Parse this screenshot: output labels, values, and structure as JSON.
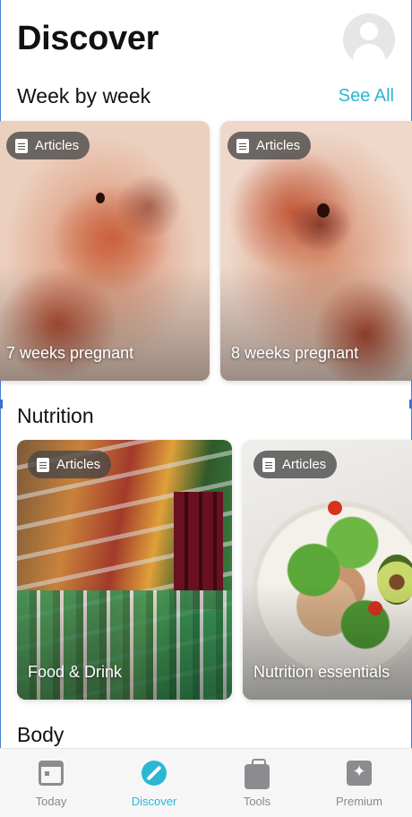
{
  "header": {
    "title": "Discover"
  },
  "week_section": {
    "title": "Week by week",
    "see_all": "See All",
    "cards": [
      {
        "badge": "Articles",
        "label": "7 weeks pregnant"
      },
      {
        "badge": "Articles",
        "label": "8 weeks pregnant"
      }
    ]
  },
  "nutrition_section": {
    "title": "Nutrition",
    "cards": [
      {
        "badge": "Articles",
        "label": "Food & Drink"
      },
      {
        "badge": "Articles",
        "label": "Nutrition essentials"
      }
    ]
  },
  "body_section": {
    "title": "Body"
  },
  "tabbar": {
    "active": "Discover",
    "accent": "#2bb7d4",
    "items": [
      {
        "label": "Today",
        "icon": "calendar-icon"
      },
      {
        "label": "Discover",
        "icon": "compass-icon"
      },
      {
        "label": "Tools",
        "icon": "toolbox-icon"
      },
      {
        "label": "Premium",
        "icon": "sparkle-icon"
      }
    ]
  }
}
